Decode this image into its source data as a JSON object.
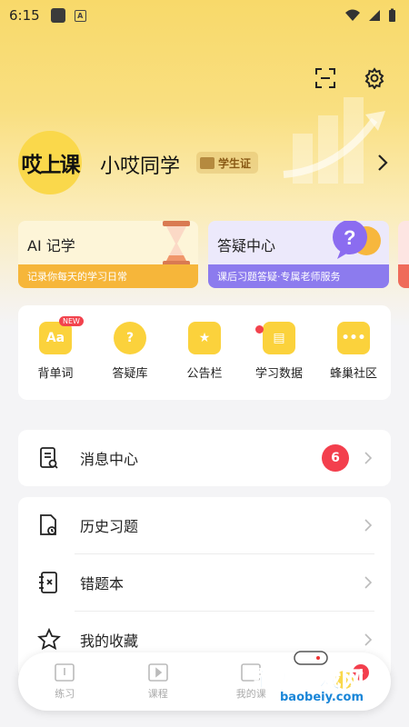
{
  "status_bar": {
    "time": "6:15"
  },
  "profile": {
    "logo_text": "哎上课",
    "username": "小哎同学",
    "badge": "学生证"
  },
  "cards": [
    {
      "title": "AI 记学",
      "subtitle": "记录你每天的学习日常"
    },
    {
      "title": "答疑中心",
      "subtitle": "课后习题答疑·专属老师服务"
    }
  ],
  "quick_icons": [
    {
      "label": "背单词",
      "tag": "NEW",
      "glyph": "Aa"
    },
    {
      "label": "答疑库",
      "glyph": "?"
    },
    {
      "label": "公告栏",
      "glyph": "★"
    },
    {
      "label": "学习数据",
      "glyph": "▤"
    },
    {
      "label": "蜂巢社区",
      "glyph": "•••"
    }
  ],
  "messages": {
    "label": "消息中心",
    "count": "6"
  },
  "menu": [
    {
      "label": "历史习题"
    },
    {
      "label": "错题本"
    },
    {
      "label": "我的收藏"
    }
  ],
  "tabbar": [
    {
      "label": "练习"
    },
    {
      "label": "课程"
    },
    {
      "label": "我的课"
    },
    {
      "label": "",
      "count": "6"
    }
  ],
  "watermark": {
    "title": "宝贝游戏网",
    "url": "baobeiy.com"
  },
  "colors": {
    "accent": "#fad84b",
    "badge_red": "#f33f4d",
    "card_orange": "#f6b63a",
    "card_purple": "#8c7bee"
  }
}
